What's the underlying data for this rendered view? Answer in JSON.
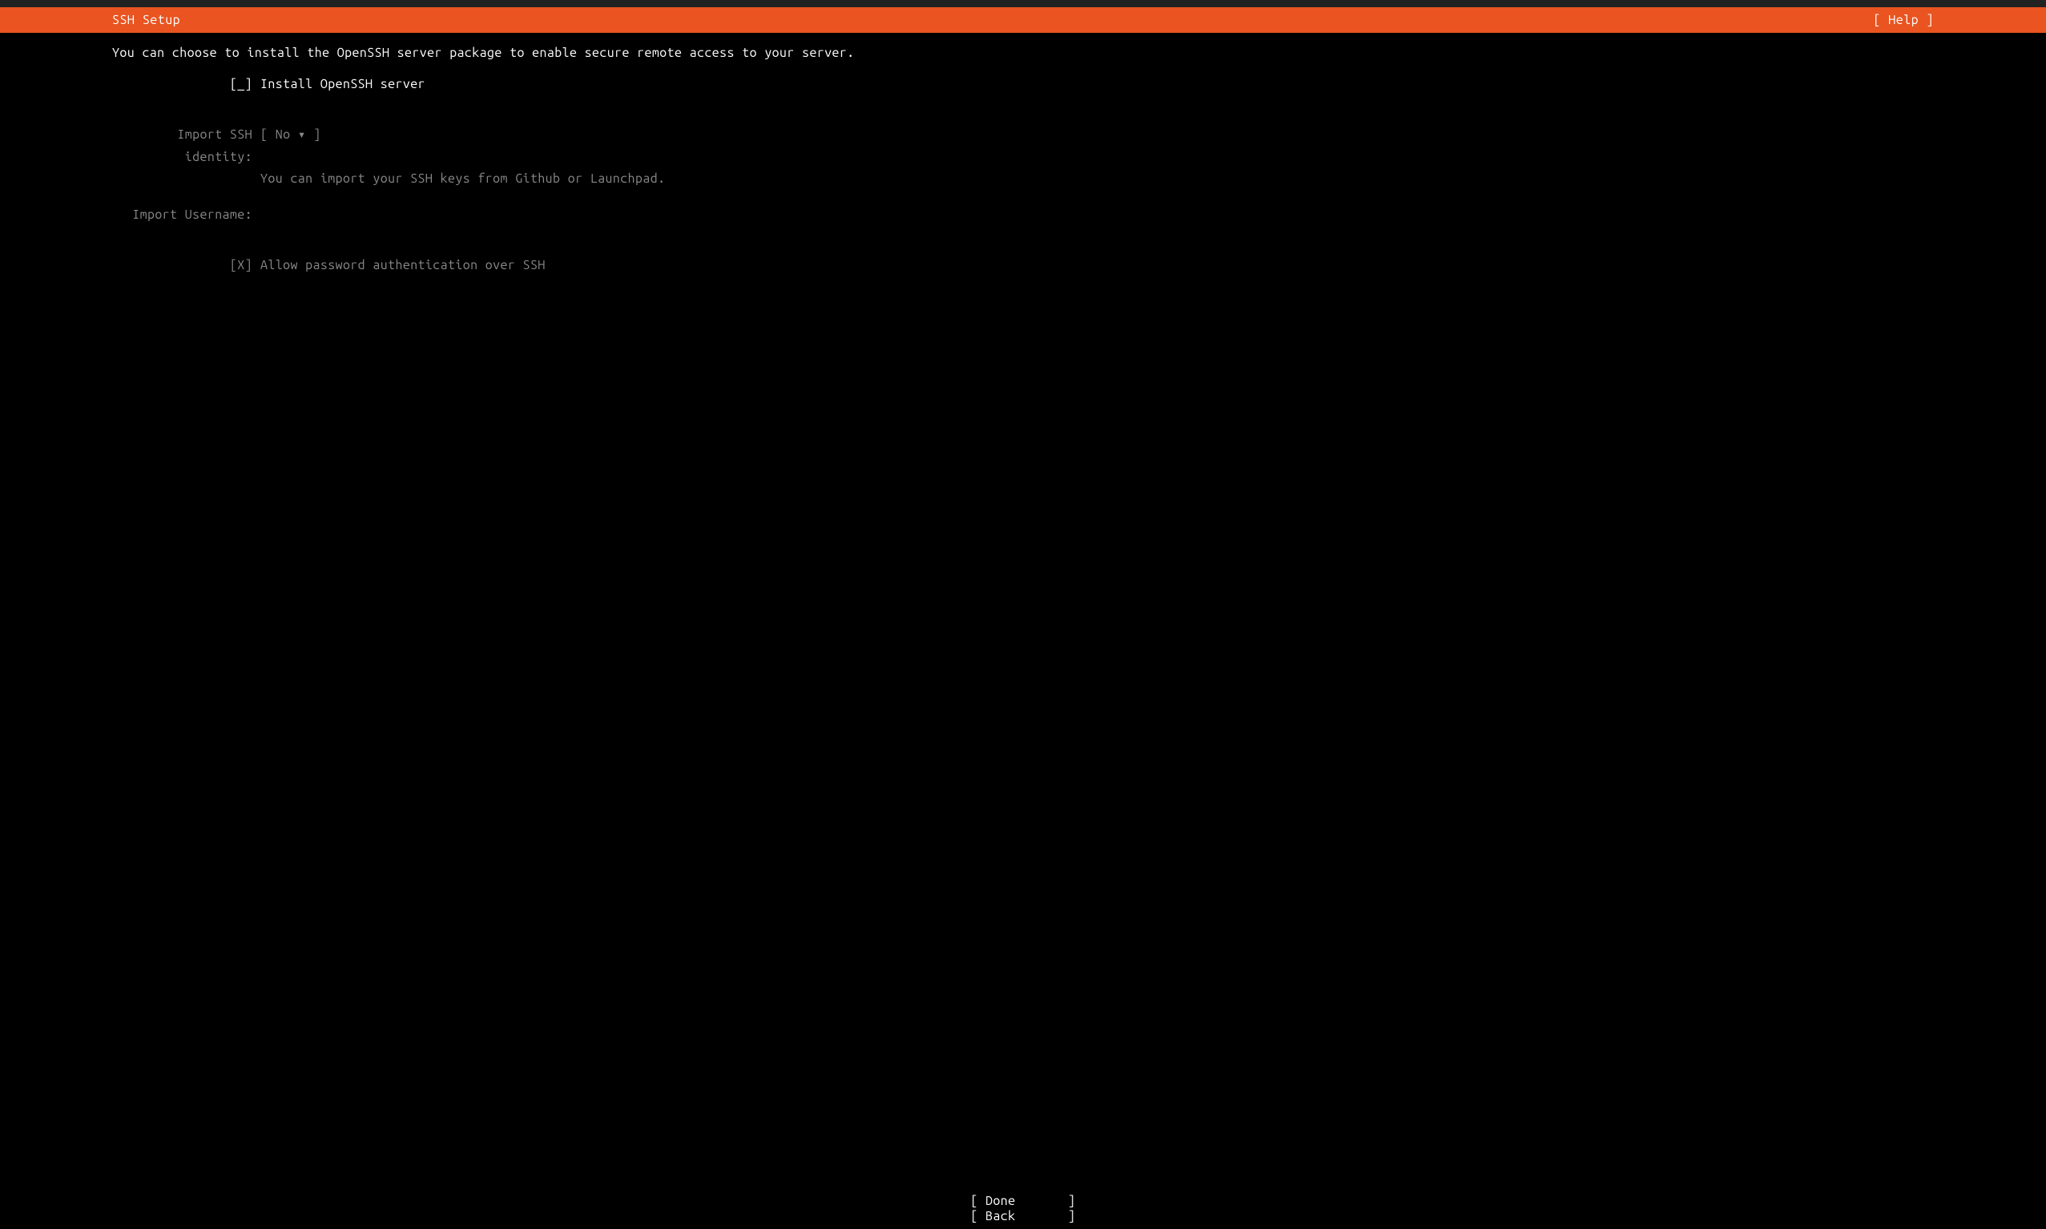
{
  "header": {
    "title": "SSH Setup",
    "help": "[ Help ]"
  },
  "description": "You can choose to install the OpenSSH server package to enable secure remote access to your server.",
  "form": {
    "install_checkbox": "[_]",
    "install_label": "Install OpenSSH server",
    "import_identity_label": "Import SSH identity:",
    "import_identity_value": "[ No             ▾ ]",
    "import_identity_help": "You can import your SSH keys from Github or Launchpad.",
    "import_username_label": "Import Username:",
    "import_username_value": "",
    "allow_password_checkbox": "[X]",
    "allow_password_label": "Allow password authentication over SSH"
  },
  "footer": {
    "done": "[ Done       ]",
    "back": "[ Back       ]"
  }
}
